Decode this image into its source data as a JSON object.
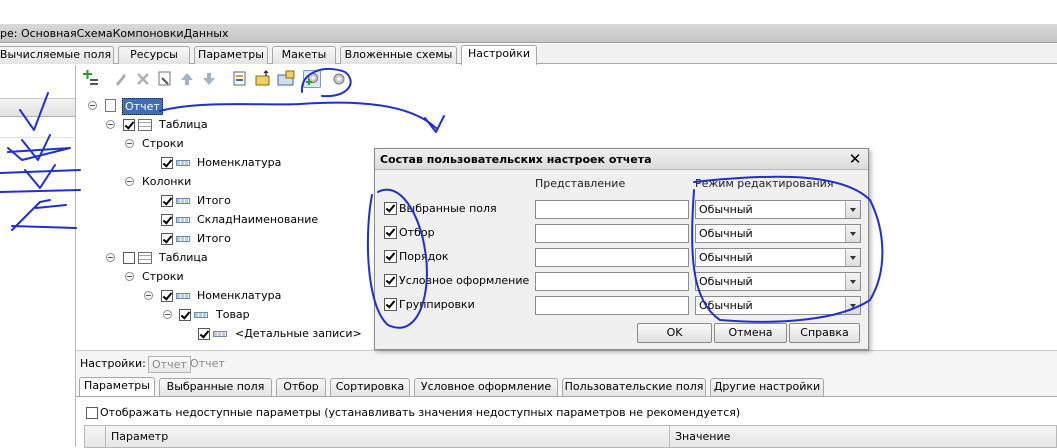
{
  "window": {
    "title": "ре: ОсновнаяСхемаКомпоновкиДанных"
  },
  "top_tabs": [
    {
      "label": "Вычисляемые поля",
      "active": false
    },
    {
      "label": "Ресурсы",
      "active": false
    },
    {
      "label": "Параметры",
      "active": false
    },
    {
      "label": "Макеты",
      "active": false
    },
    {
      "label": "Вложенные схемы",
      "active": false
    },
    {
      "label": "Настройки",
      "active": true
    }
  ],
  "toolbar": {
    "icons": [
      "add-icon",
      "edit-icon",
      "delete-icon",
      "properties-icon",
      "move-up-icon",
      "move-down-icon",
      "group-icon",
      "insert-icon",
      "table-icon",
      "user-settings-icon",
      "options-icon"
    ]
  },
  "tree": {
    "root": "Отчет",
    "table1": "Таблица",
    "rows1": "Строки",
    "nomenclature1": "Номенклатура",
    "columns": "Колонки",
    "total1": "Итого",
    "warehouse": "СкладНаименование",
    "total2": "Итого",
    "table2": "Таблица",
    "rows2": "Строки",
    "nomenclature2": "Номенклатура",
    "goods": "Товар",
    "details": "<Детальные записи>"
  },
  "dialog": {
    "title": "Состав пользовательских настроек отчета",
    "col_presentation": "Представление",
    "col_mode": "Режим редактирования",
    "rows": [
      {
        "label": "Выбранные поля",
        "checked": true,
        "presentation": "",
        "mode": "Обычный"
      },
      {
        "label": "Отбор",
        "checked": true,
        "presentation": "",
        "mode": "Обычный"
      },
      {
        "label": "Порядок",
        "checked": true,
        "presentation": "",
        "mode": "Обычный"
      },
      {
        "label": "Условное оформление",
        "checked": true,
        "presentation": "",
        "mode": "Обычный"
      },
      {
        "label": "Группировки",
        "checked": true,
        "presentation": "",
        "mode": "Обычный"
      }
    ],
    "ok_label": "OK",
    "cancel_label": "Отмена",
    "help_label": "Справка",
    "close_glyph": "✕"
  },
  "bottom": {
    "settings_label": "Настройки:",
    "settings_btn": "Отчет",
    "settings_value": "Отчет",
    "tabs": [
      {
        "label": "Параметры",
        "active": true
      },
      {
        "label": "Выбранные поля",
        "active": false
      },
      {
        "label": "Отбор",
        "active": false
      },
      {
        "label": "Сортировка",
        "active": false
      },
      {
        "label": "Условное оформление",
        "active": false
      },
      {
        "label": "Пользовательские поля",
        "active": false
      },
      {
        "label": "Другие настройки",
        "active": false
      }
    ],
    "show_unavailable": "Отображать недоступные параметры (устанавливать значения недоступных параметров не рекомендуется)",
    "grid_col_param": "Параметр",
    "grid_col_value": "Значение"
  },
  "colors": {
    "selection": "#3f6fb8",
    "ink": "#1f2fd0"
  }
}
